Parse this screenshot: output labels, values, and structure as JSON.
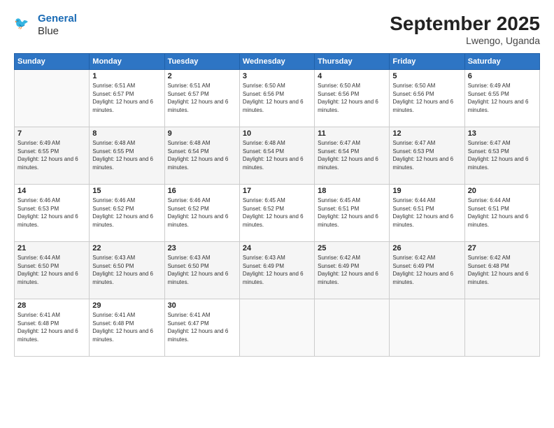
{
  "header": {
    "logo_line1": "General",
    "logo_line2": "Blue",
    "month": "September 2025",
    "location": "Lwengo, Uganda"
  },
  "weekdays": [
    "Sunday",
    "Monday",
    "Tuesday",
    "Wednesday",
    "Thursday",
    "Friday",
    "Saturday"
  ],
  "weeks": [
    [
      {
        "day": "",
        "sunrise": "",
        "sunset": "",
        "daylight": ""
      },
      {
        "day": "1",
        "sunrise": "Sunrise: 6:51 AM",
        "sunset": "Sunset: 6:57 PM",
        "daylight": "Daylight: 12 hours and 6 minutes."
      },
      {
        "day": "2",
        "sunrise": "Sunrise: 6:51 AM",
        "sunset": "Sunset: 6:57 PM",
        "daylight": "Daylight: 12 hours and 6 minutes."
      },
      {
        "day": "3",
        "sunrise": "Sunrise: 6:50 AM",
        "sunset": "Sunset: 6:56 PM",
        "daylight": "Daylight: 12 hours and 6 minutes."
      },
      {
        "day": "4",
        "sunrise": "Sunrise: 6:50 AM",
        "sunset": "Sunset: 6:56 PM",
        "daylight": "Daylight: 12 hours and 6 minutes."
      },
      {
        "day": "5",
        "sunrise": "Sunrise: 6:50 AM",
        "sunset": "Sunset: 6:56 PM",
        "daylight": "Daylight: 12 hours and 6 minutes."
      },
      {
        "day": "6",
        "sunrise": "Sunrise: 6:49 AM",
        "sunset": "Sunset: 6:55 PM",
        "daylight": "Daylight: 12 hours and 6 minutes."
      }
    ],
    [
      {
        "day": "7",
        "sunrise": "Sunrise: 6:49 AM",
        "sunset": "Sunset: 6:55 PM",
        "daylight": "Daylight: 12 hours and 6 minutes."
      },
      {
        "day": "8",
        "sunrise": "Sunrise: 6:48 AM",
        "sunset": "Sunset: 6:55 PM",
        "daylight": "Daylight: 12 hours and 6 minutes."
      },
      {
        "day": "9",
        "sunrise": "Sunrise: 6:48 AM",
        "sunset": "Sunset: 6:54 PM",
        "daylight": "Daylight: 12 hours and 6 minutes."
      },
      {
        "day": "10",
        "sunrise": "Sunrise: 6:48 AM",
        "sunset": "Sunset: 6:54 PM",
        "daylight": "Daylight: 12 hours and 6 minutes."
      },
      {
        "day": "11",
        "sunrise": "Sunrise: 6:47 AM",
        "sunset": "Sunset: 6:54 PM",
        "daylight": "Daylight: 12 hours and 6 minutes."
      },
      {
        "day": "12",
        "sunrise": "Sunrise: 6:47 AM",
        "sunset": "Sunset: 6:53 PM",
        "daylight": "Daylight: 12 hours and 6 minutes."
      },
      {
        "day": "13",
        "sunrise": "Sunrise: 6:47 AM",
        "sunset": "Sunset: 6:53 PM",
        "daylight": "Daylight: 12 hours and 6 minutes."
      }
    ],
    [
      {
        "day": "14",
        "sunrise": "Sunrise: 6:46 AM",
        "sunset": "Sunset: 6:53 PM",
        "daylight": "Daylight: 12 hours and 6 minutes."
      },
      {
        "day": "15",
        "sunrise": "Sunrise: 6:46 AM",
        "sunset": "Sunset: 6:52 PM",
        "daylight": "Daylight: 12 hours and 6 minutes."
      },
      {
        "day": "16",
        "sunrise": "Sunrise: 6:46 AM",
        "sunset": "Sunset: 6:52 PM",
        "daylight": "Daylight: 12 hours and 6 minutes."
      },
      {
        "day": "17",
        "sunrise": "Sunrise: 6:45 AM",
        "sunset": "Sunset: 6:52 PM",
        "daylight": "Daylight: 12 hours and 6 minutes."
      },
      {
        "day": "18",
        "sunrise": "Sunrise: 6:45 AM",
        "sunset": "Sunset: 6:51 PM",
        "daylight": "Daylight: 12 hours and 6 minutes."
      },
      {
        "day": "19",
        "sunrise": "Sunrise: 6:44 AM",
        "sunset": "Sunset: 6:51 PM",
        "daylight": "Daylight: 12 hours and 6 minutes."
      },
      {
        "day": "20",
        "sunrise": "Sunrise: 6:44 AM",
        "sunset": "Sunset: 6:51 PM",
        "daylight": "Daylight: 12 hours and 6 minutes."
      }
    ],
    [
      {
        "day": "21",
        "sunrise": "Sunrise: 6:44 AM",
        "sunset": "Sunset: 6:50 PM",
        "daylight": "Daylight: 12 hours and 6 minutes."
      },
      {
        "day": "22",
        "sunrise": "Sunrise: 6:43 AM",
        "sunset": "Sunset: 6:50 PM",
        "daylight": "Daylight: 12 hours and 6 minutes."
      },
      {
        "day": "23",
        "sunrise": "Sunrise: 6:43 AM",
        "sunset": "Sunset: 6:50 PM",
        "daylight": "Daylight: 12 hours and 6 minutes."
      },
      {
        "day": "24",
        "sunrise": "Sunrise: 6:43 AM",
        "sunset": "Sunset: 6:49 PM",
        "daylight": "Daylight: 12 hours and 6 minutes."
      },
      {
        "day": "25",
        "sunrise": "Sunrise: 6:42 AM",
        "sunset": "Sunset: 6:49 PM",
        "daylight": "Daylight: 12 hours and 6 minutes."
      },
      {
        "day": "26",
        "sunrise": "Sunrise: 6:42 AM",
        "sunset": "Sunset: 6:49 PM",
        "daylight": "Daylight: 12 hours and 6 minutes."
      },
      {
        "day": "27",
        "sunrise": "Sunrise: 6:42 AM",
        "sunset": "Sunset: 6:48 PM",
        "daylight": "Daylight: 12 hours and 6 minutes."
      }
    ],
    [
      {
        "day": "28",
        "sunrise": "Sunrise: 6:41 AM",
        "sunset": "Sunset: 6:48 PM",
        "daylight": "Daylight: 12 hours and 6 minutes."
      },
      {
        "day": "29",
        "sunrise": "Sunrise: 6:41 AM",
        "sunset": "Sunset: 6:48 PM",
        "daylight": "Daylight: 12 hours and 6 minutes."
      },
      {
        "day": "30",
        "sunrise": "Sunrise: 6:41 AM",
        "sunset": "Sunset: 6:47 PM",
        "daylight": "Daylight: 12 hours and 6 minutes."
      },
      {
        "day": "",
        "sunrise": "",
        "sunset": "",
        "daylight": ""
      },
      {
        "day": "",
        "sunrise": "",
        "sunset": "",
        "daylight": ""
      },
      {
        "day": "",
        "sunrise": "",
        "sunset": "",
        "daylight": ""
      },
      {
        "day": "",
        "sunrise": "",
        "sunset": "",
        "daylight": ""
      }
    ]
  ]
}
